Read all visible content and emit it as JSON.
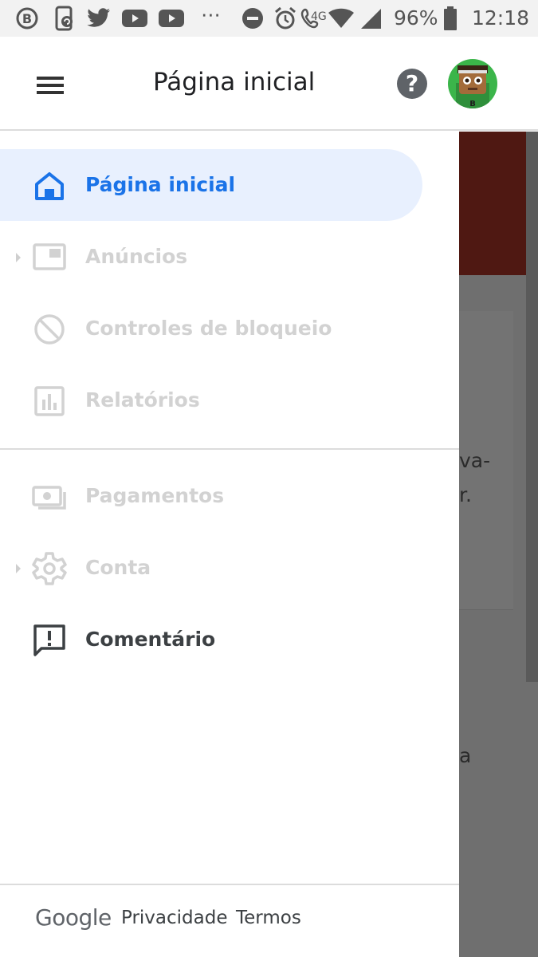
{
  "status_bar": {
    "battery_percent": "96%",
    "time": "12:18",
    "network_label": "4G",
    "more_glyph": "⋯",
    "icons": [
      "b-icon",
      "phone-sync-icon",
      "twitter-icon",
      "youtube-icon",
      "youtube-icon",
      "more-icon",
      "do-not-disturb-icon",
      "alarm-icon",
      "wifi-call-icon",
      "wifi-icon",
      "signal-icon",
      "battery-icon"
    ]
  },
  "header": {
    "title": "Página inicial",
    "help_glyph": "?"
  },
  "drawer": {
    "items": [
      {
        "label": "Página inicial",
        "icon": "home-icon",
        "state": "active"
      },
      {
        "label": "Anúncios",
        "icon": "ads-icon",
        "state": "disabled",
        "expandable": true
      },
      {
        "label": "Controles de bloqueio",
        "icon": "block-icon",
        "state": "disabled"
      },
      {
        "label": "Relatórios",
        "icon": "reports-icon",
        "state": "disabled"
      },
      {
        "label": "Pagamentos",
        "icon": "payments-icon",
        "state": "disabled"
      },
      {
        "label": "Conta",
        "icon": "settings-icon",
        "state": "disabled",
        "expandable": true
      },
      {
        "label": "Comentário",
        "icon": "feedback-icon",
        "state": "normal"
      }
    ],
    "footer": {
      "brand": "Google",
      "privacy": "Privacidade",
      "terms": "Termos"
    }
  },
  "background_page": {
    "text_lines": [
      "va-",
      "r.",
      "a"
    ]
  },
  "colors": {
    "accent": "#1a73e8",
    "active_bg": "#e8f0fe",
    "disabled": "#d2d2d2",
    "text": "#3c4043",
    "scrim": "#6f6f6f",
    "banner": "#4f1812"
  }
}
